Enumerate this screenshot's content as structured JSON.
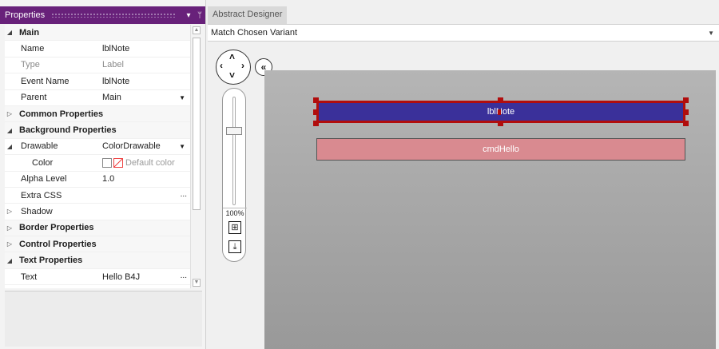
{
  "properties_panel": {
    "title": "Properties",
    "pin_icon": "pin-icon",
    "menu_icon": "chevron-down-icon",
    "rows": [
      {
        "type": "category",
        "label": "Main",
        "expanded": true
      },
      {
        "type": "prop",
        "key": "Name",
        "value": "lblNote"
      },
      {
        "type": "prop",
        "key": "Type",
        "value": "Label",
        "disabled": true
      },
      {
        "type": "prop",
        "key": "Event Name",
        "value": "lblNote"
      },
      {
        "type": "prop",
        "key": "Parent",
        "value": "Main",
        "dropdown": true
      },
      {
        "type": "category",
        "label": "Common Properties",
        "expanded": false
      },
      {
        "type": "category",
        "label": "Background Properties",
        "expanded": true
      },
      {
        "type": "prop",
        "key": "Drawable",
        "value": "ColorDrawable",
        "dropdown": true,
        "expander": true
      },
      {
        "type": "prop",
        "key": "Color",
        "value": "Default color",
        "color": true,
        "sub": true
      },
      {
        "type": "prop",
        "key": "Alpha Level",
        "value": "1.0"
      },
      {
        "type": "prop",
        "key": "Extra CSS",
        "value": "",
        "ellipsis": true
      },
      {
        "type": "prop",
        "key": "Shadow",
        "value": "",
        "expander_collapsed": true
      },
      {
        "type": "category",
        "label": "Border Properties",
        "expanded": false
      },
      {
        "type": "category",
        "label": "Control Properties",
        "expanded": false
      },
      {
        "type": "category",
        "label": "Text Properties",
        "expanded": true
      },
      {
        "type": "prop",
        "key": "Text",
        "value": "Hello B4J",
        "ellipsis": true
      }
    ]
  },
  "designer": {
    "tab_label": "Abstract Designer",
    "variant_label": "Match Chosen Variant",
    "zoom_label": "100%",
    "views": {
      "label": "lblNote",
      "button": "cmdHello"
    },
    "colors": {
      "label_bg": "#3a309a",
      "selection": "#b10d0d",
      "button_bg": "#d98a90"
    }
  }
}
